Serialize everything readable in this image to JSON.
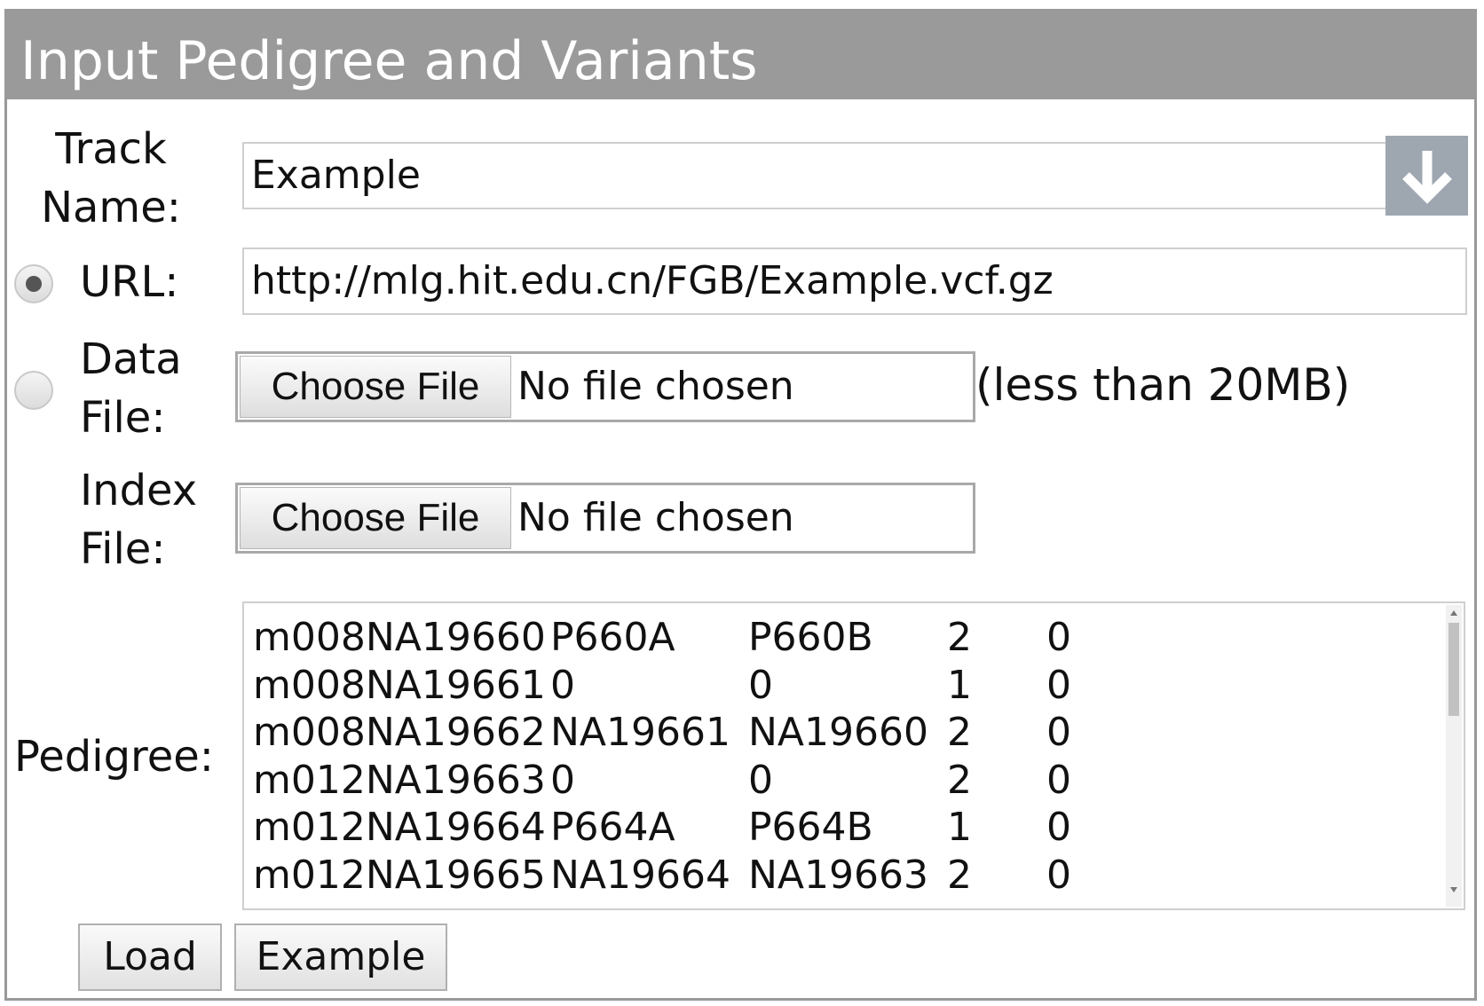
{
  "panel": {
    "title": "Input Pedigree and Variants"
  },
  "track": {
    "label_line1": "Track",
    "label_line2": "Name:",
    "value": "Example",
    "dropdown_icon": "arrow-down-icon"
  },
  "url": {
    "label": "URL:",
    "selected": true,
    "value": "http://mlg.hit.edu.cn/FGB/Example.vcf.gz"
  },
  "data_file": {
    "label_line1": "Data",
    "label_line2": "File:",
    "selected": false,
    "button_label": "Choose File",
    "status": "No file chosen",
    "note": "(less than 20MB)"
  },
  "index_file": {
    "label_line1": "Index",
    "label_line2": "File:",
    "button_label": "Choose File",
    "status": "No file chosen"
  },
  "pedigree": {
    "label": "Pedigree:",
    "rows": [
      [
        "m008NA19660",
        "P660A",
        "P660B",
        "2",
        "0"
      ],
      [
        "m008NA19661",
        "0",
        "0",
        "1",
        "0"
      ],
      [
        "m008NA19662",
        "NA19661",
        "NA19660",
        "2",
        "0"
      ],
      [
        "m012NA19663",
        "0",
        "0",
        "2",
        "0"
      ],
      [
        "m012NA19664",
        "P664A",
        "P664B",
        "1",
        "0"
      ],
      [
        "m012NA19665",
        "NA19664",
        "NA19663",
        "2",
        "0"
      ]
    ]
  },
  "actions": {
    "load_label": "Load",
    "example_label": "Example"
  }
}
